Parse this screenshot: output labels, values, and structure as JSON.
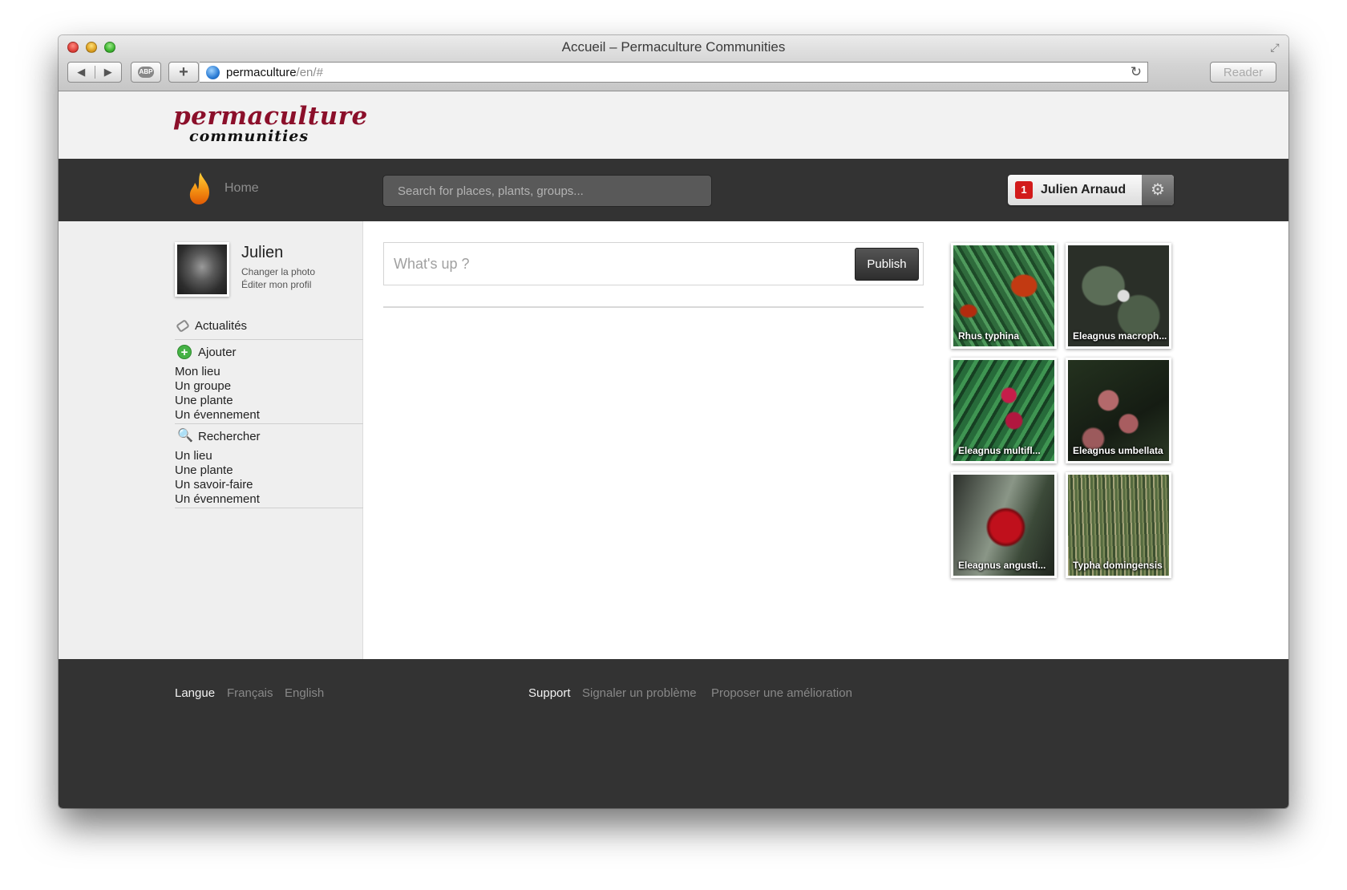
{
  "window": {
    "title": "Accueil – Permaculture Communities"
  },
  "toolbar": {
    "back_glyph": "◀",
    "forward_glyph": "▶",
    "abp_label": "ABP",
    "add_glyph": "+",
    "url_host": "permaculture",
    "url_path": "/en/#",
    "reload_glyph": "↻",
    "reader_label": "Reader",
    "fullscreen_glyph": "⤢"
  },
  "brand": {
    "logo_top": "permaculture",
    "logo_bottom": "communities",
    "logo_color": "#8b0f2a"
  },
  "nav": {
    "home_label": "Home",
    "search_placeholder": "Search for places, plants, groups...",
    "notification_count": "1",
    "user_name": "Julien Arnaud",
    "gear_glyph": "⚙"
  },
  "profile": {
    "name": "Julien",
    "change_photo": "Changer la photo",
    "edit_profile": "Éditer mon profil"
  },
  "sidebar": {
    "news_label": "Actualités",
    "add": {
      "label": "Ajouter",
      "icon_glyph": "+",
      "items": [
        "Mon lieu",
        "Un groupe",
        "Une plante",
        "Un évennement"
      ]
    },
    "search": {
      "label": "Rechercher",
      "icon_glyph": "🔍",
      "items": [
        "Un lieu",
        "Une plante",
        "Un savoir-faire",
        "Un évennement"
      ]
    }
  },
  "composer": {
    "placeholder": "What's up ?",
    "publish_label": "Publish"
  },
  "plants": [
    {
      "name": "Rhus typhina"
    },
    {
      "name": "Eleagnus macroph..."
    },
    {
      "name": "Eleagnus multifl..."
    },
    {
      "name": "Eleagnus umbellata"
    },
    {
      "name": "Eleagnus angusti..."
    },
    {
      "name": "Typha domingensis"
    }
  ],
  "footer": {
    "language_label": "Langue",
    "lang_fr": "Français",
    "lang_en": "English",
    "support_label": "Support",
    "report_problem": "Signaler un problème",
    "suggest_improvement": "Proposer une amélioration"
  },
  "colors": {
    "navbar_bg": "#333333",
    "notification_red": "#d21b1b",
    "sidebar_bg": "#efefef"
  }
}
